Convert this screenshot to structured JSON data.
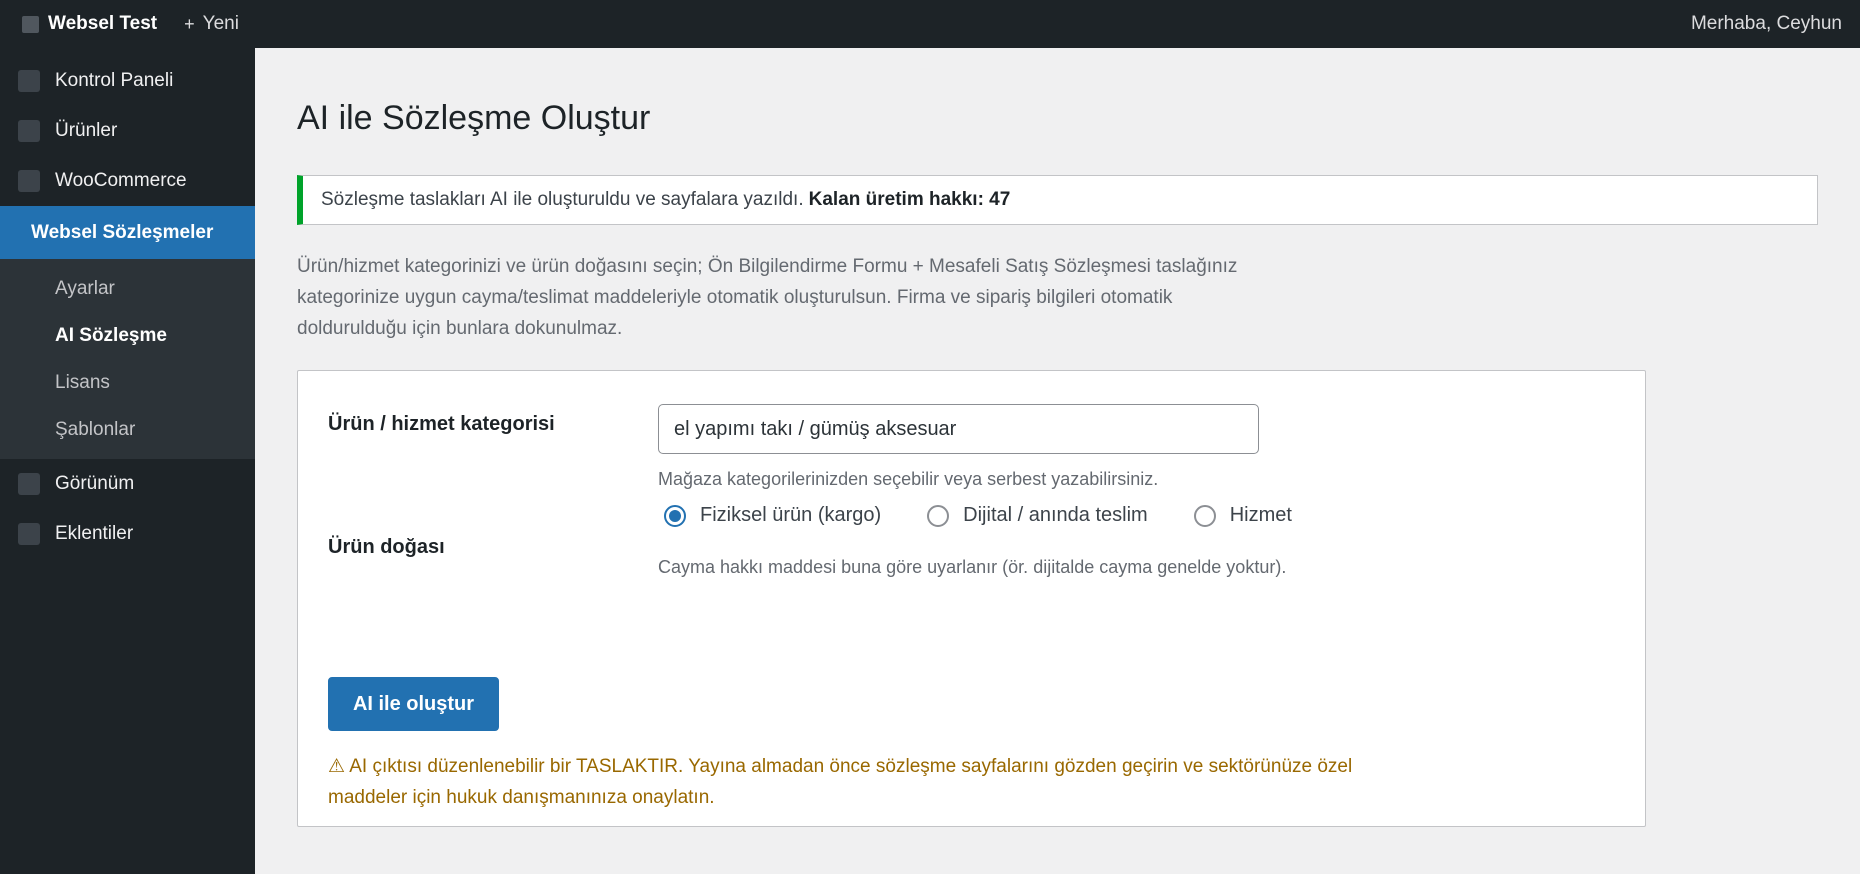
{
  "adminbar": {
    "site_name": "Websel Test",
    "new_label": "Yeni",
    "new_icon": "+",
    "greeting": "Merhaba, Ceyhun"
  },
  "sidebar": {
    "items_top": [
      {
        "label": "Kontrol Paneli",
        "icon": "dashboard-icon"
      },
      {
        "label": "Ürünler",
        "icon": "products-icon"
      },
      {
        "label": "WooCommerce",
        "icon": "woocommerce-icon"
      }
    ],
    "active_item": {
      "label": "Websel Sözleşmeler"
    },
    "submenu": [
      {
        "label": "Ayarlar",
        "current": false
      },
      {
        "label": "AI Sözleşme",
        "current": true
      },
      {
        "label": "Lisans",
        "current": false
      },
      {
        "label": "Şablonlar",
        "current": false
      }
    ],
    "items_bottom": [
      {
        "label": "Görünüm",
        "icon": "appearance-icon"
      },
      {
        "label": "Eklentiler",
        "icon": "plugins-icon"
      }
    ]
  },
  "main": {
    "title": "AI ile Sözleşme Oluştur",
    "notice": {
      "text": "Sözleşme taslakları AI ile oluşturuldu ve sayfalara yazıldı.",
      "bold": "Kalan üretim hakkı: 47",
      "color": "#00a32a"
    },
    "intro": "Ürün/hizmet kategorinizi ve ürün doğasını seçin; Ön Bilgilendirme Formu + Mesafeli Satış Sözleşmesi taslağınız kategorinize uygun cayma/teslimat maddeleriyle otomatik oluşturulsun. Firma ve sipariş bilgileri otomatik doldurulduğu için bunlara dokunulmaz.",
    "form": {
      "category_label": "Ürün / hizmet kategorisi",
      "category_value": "el yapımı takı / gümüş aksesuar",
      "category_help": "Mağaza kategorilerinizden seçebilir veya serbest yazabilirsiniz.",
      "nature_label": "Ürün doğası",
      "nature_options": [
        {
          "label": "Fiziksel ürün (kargo)",
          "checked": true
        },
        {
          "label": "Dijital / anında teslim",
          "checked": false
        },
        {
          "label": "Hizmet",
          "checked": false
        }
      ],
      "nature_help": "Cayma hakkı maddesi buna göre uyarlanır (ör. dijitalde cayma genelde yoktur).",
      "submit_label": "AI ile oluştur",
      "warning": "⚠ AI çıktısı düzenlenebilir bir TASLAKTIR. Yayına almadan önce sözleşme sayfalarını gözden geçirin ve sektörünüze özel maddeler için hukuk danışmanınıza onaylatın."
    }
  },
  "colors": {
    "accent": "#2271b1",
    "sidebar_bg": "#1d2327",
    "warning": "#996800"
  }
}
